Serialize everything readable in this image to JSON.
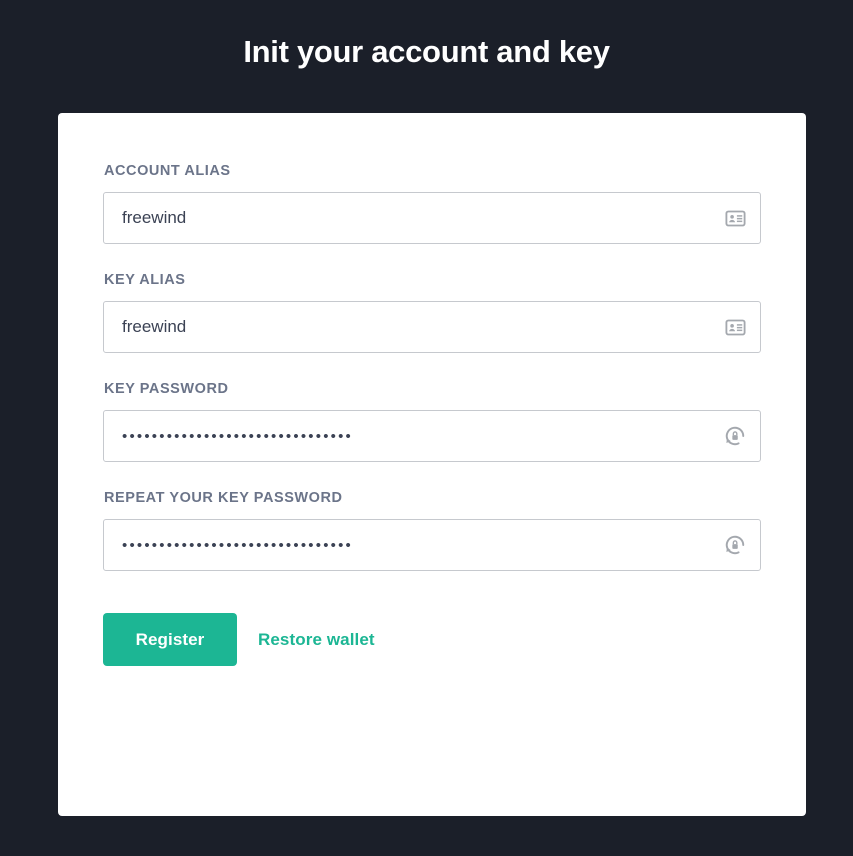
{
  "page": {
    "title": "Init your account and key",
    "background_color": "#1b1f29",
    "card_background": "#ffffff",
    "accent_color": "#1cb694",
    "label_color": "#6b7489"
  },
  "form": {
    "fields": [
      {
        "label": "ACCOUNT ALIAS",
        "type": "text",
        "value": "freewind",
        "placeholder": "",
        "icon": "id-card-icon"
      },
      {
        "label": "KEY ALIAS",
        "type": "text",
        "value": "freewind",
        "placeholder": "",
        "icon": "id-card-icon"
      },
      {
        "label": "KEY PASSWORD",
        "type": "password",
        "value": "•••••••••••••••••••••••••••••••",
        "placeholder": "",
        "icon": "lock-reset-icon"
      },
      {
        "label": "REPEAT YOUR KEY PASSWORD",
        "type": "password",
        "value": "•••••••••••••••••••••••••••••••",
        "placeholder": "",
        "icon": "lock-reset-icon"
      }
    ],
    "submit_label": "Register",
    "restore_label": "Restore wallet"
  }
}
